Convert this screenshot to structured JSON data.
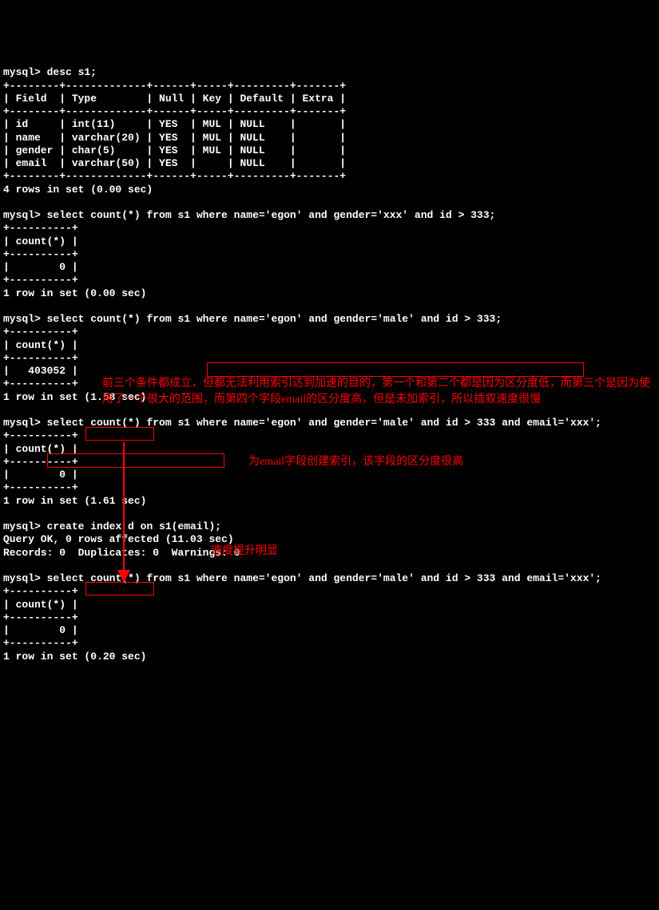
{
  "prompt": "mysql>",
  "cmds": {
    "desc": "desc s1;",
    "q1": "select count(*) from s1 where name='egon' and gender='xxx' and id > 333;",
    "q2": "select count(*) from s1 where name='egon' and gender='male' and id > 333;",
    "q3": "select count(*) from s1 where name='egon' and gender='male' and id > 333 and email='xxx';",
    "createIndex": "create index d on s1(email);",
    "q4": "select count(*) from s1 where name='egon' and gender='male' and id > 333 and email='xxx';"
  },
  "describeTable": {
    "sep": "+--------+-------------+------+-----+---------+-------+",
    "header": "| Field  | Type        | Null | Key | Default | Extra |",
    "rows": [
      "| id     | int(11)     | YES  | MUL | NULL    |       |",
      "| name   | varchar(20) | YES  | MUL | NULL    |       |",
      "| gender | char(5)     | YES  | MUL | NULL    |       |",
      "| email  | varchar(50) | YES  |     | NULL    |       |"
    ],
    "summary": "4 rows in set (0.00 sec)"
  },
  "countHeader": {
    "sep": "+----------+",
    "label": "| count(*) |"
  },
  "results": {
    "q1": {
      "row": "|        0 |",
      "summary_prefix": "1 row in set ",
      "timing": "(0.00 sec)"
    },
    "q2": {
      "row": "|   403052 |",
      "summary_prefix": "1 row in set ",
      "timing": "(1.58 sec)"
    },
    "q3": {
      "row": "|        0 |",
      "summary_prefix": "1 row in set ",
      "timing": "(1.61 sec)"
    },
    "q4": {
      "row": "|        0 |",
      "summary_prefix": "1 row in set ",
      "timing": "(0.20 sec)"
    }
  },
  "createIndexResult": {
    "line1": "Query OK, 0 rows affected (11.03 sec)",
    "line2": "Records: 0  Duplicates: 0  Warnings: 0"
  },
  "annotations": {
    "a1": "前三个条件都成立，但都无法利用索引达到加速的目的，第一个和第二个都是因为区分度低，而第三个是因为使用了一个很大的范围，而第四个字段email的区分度高，但是未加索引，所以插叙速度很慢",
    "a2": "为email字段创建索引，该字段的区分度很高",
    "a3": "速度提升明显"
  }
}
